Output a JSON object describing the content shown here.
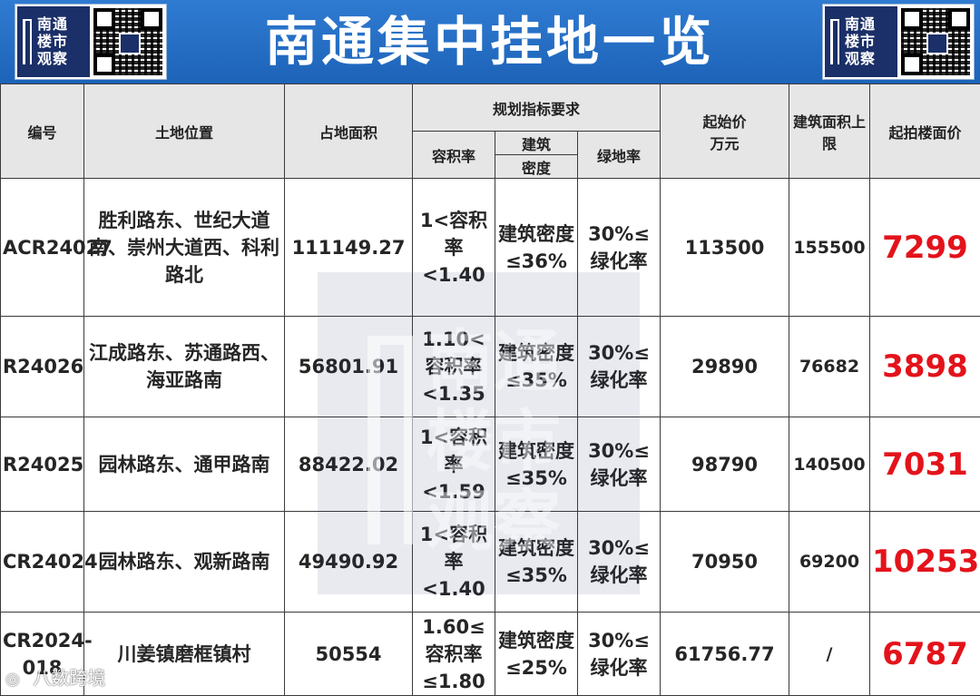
{
  "header": {
    "title": "南通集中挂地一览",
    "logo_text": [
      "南通",
      "楼市",
      "观察"
    ]
  },
  "table": {
    "columns": {
      "id": "编号",
      "location": "土地位置",
      "area": "占地面积",
      "planning_group": "规划指标要求",
      "far": "容积率",
      "density_top": "建筑",
      "density_bottom": "密度",
      "green": "绿地率",
      "start_price_top": "起始价",
      "start_price_bottom": "万元",
      "gfa_cap": "建筑面积上限",
      "floor_price": "起拍楼面价"
    },
    "rows": [
      {
        "id": "ACR24027",
        "location": "胜利路东、世纪大道南、崇州大道西、科利路北",
        "area": "111149.27",
        "far": "1<容积率<1.40",
        "density": "建筑密度≤36%",
        "green": "30%≤绿化率",
        "start_price": "113500",
        "gfa_cap": "155500",
        "floor_price": "7299"
      },
      {
        "id": "R24026",
        "location": "江成路东、苏通路西、海亚路南",
        "area": "56801.91",
        "far": "1.10<容积率<1.35",
        "density": "建筑密度≤35%",
        "green": "30%≤绿化率",
        "start_price": "29890",
        "gfa_cap": "76682",
        "floor_price": "3898"
      },
      {
        "id": "R24025",
        "location": "园林路东、通甲路南",
        "area": "88422.02",
        "far": "1<容积率<1.59",
        "density": "建筑密度≤35%",
        "green": "30%≤绿化率",
        "start_price": "98790",
        "gfa_cap": "140500",
        "floor_price": "7031"
      },
      {
        "id": "CR24024",
        "location": "园林路东、观新路南",
        "area": "49490.92",
        "far": "1<容积率<1.40",
        "density": "建筑密度≤35%",
        "green": "30%≤绿化率",
        "start_price": "70950",
        "gfa_cap": "69200",
        "floor_price": "10253"
      },
      {
        "id": "CR2024-018",
        "location": "川姜镇磨框镇村",
        "area": "50554",
        "far": "1.60≤容积率≤1.80",
        "density": "建筑密度≤25%",
        "green": "30%≤绿化率",
        "start_price": "61756.77",
        "gfa_cap": "/",
        "floor_price": "6787"
      }
    ]
  },
  "watermark": [
    "南通",
    "楼市",
    "观察"
  ],
  "credit": "八数跨境",
  "colors": {
    "banner": "#1d63b8",
    "logo_bg": "#1b2f68",
    "price": "#e3131b",
    "header_bg": "#e6e6e6"
  }
}
